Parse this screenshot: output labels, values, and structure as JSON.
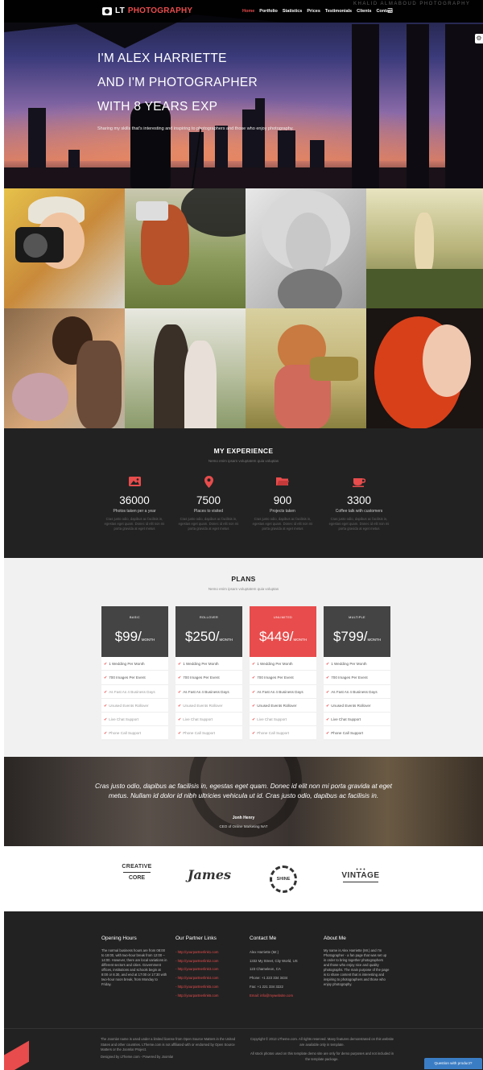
{
  "header": {
    "logo_prefix": "LT",
    "logo_accent": "PHOTOGRAPHY",
    "nav": [
      "Home",
      "Portfolio",
      "Statistics",
      "Prices",
      "Testimonials",
      "Clients",
      "Contact"
    ],
    "watermark": "KHALID ALMABOUD PHOTOGRAPHY"
  },
  "hero": {
    "lines": [
      "I'M ALEX HARRIETTE",
      "AND I'M PHOTOGRAPHER",
      "WITH 8 YEARS EXP"
    ],
    "subtitle": "Sharing my skills that's interesting and inspiring to photographers and those who enjoy photography."
  },
  "experience": {
    "title": "MY EXPERIENCE",
    "subtitle": "Nemo enim ipsam voluptatem quia voluptas",
    "stats": [
      {
        "icon": "image-icon",
        "number": "36000",
        "label": "Photos taken per a year",
        "desc": "Cras justo odio, dapibus ac facilisis in, egestas eget quam. Donec id elit non mi porta gravida at eget metus"
      },
      {
        "icon": "map-pin-icon",
        "number": "7500",
        "label": "Places to visited",
        "desc": "Cras justo odio, dapibus ac facilisis in, egestas eget quam. Donec id elit non mi porta gravida at eget metus"
      },
      {
        "icon": "folder-icon",
        "number": "900",
        "label": "Projects taken",
        "desc": "Cras justo odio, dapibus ac facilisis in, egestas eget quam. Donec id elit non mi porta gravida at eget metus"
      },
      {
        "icon": "coffee-icon",
        "number": "3300",
        "label": "Coffee talk with customers",
        "desc": "Cras justo odio, dapibus ac facilisis in, egestas eget quam. Donec id elit non mi porta gravida at eget metus"
      }
    ]
  },
  "plans": {
    "title": "PLANS",
    "subtitle": "Nemo enim ipsam voluptatem quia voluptas",
    "per": "MONTH",
    "items": [
      {
        "name": "BASIC",
        "price": "$99/",
        "highlight": false,
        "features": [
          [
            "1 Wedding Per Month",
            true
          ],
          [
            "700 Images Per Event",
            true
          ],
          [
            "As Fast As 4 Business Days",
            false
          ],
          [
            "Unused Events Rollover",
            false
          ],
          [
            "Live Chat Support",
            false
          ],
          [
            "Phone Call Support",
            false
          ]
        ]
      },
      {
        "name": "ROLLOVER",
        "price": "$250/",
        "highlight": false,
        "features": [
          [
            "1 Wedding Per Month",
            true
          ],
          [
            "700 Images Per Event",
            true
          ],
          [
            "As Fast As 4 Business Days",
            true
          ],
          [
            "Unused Events Rollover",
            false
          ],
          [
            "Live Chat Support",
            false
          ],
          [
            "Phone Call Support",
            false
          ]
        ]
      },
      {
        "name": "UNLIMITED",
        "price": "$449/",
        "highlight": true,
        "features": [
          [
            "1 Wedding Per Month",
            true
          ],
          [
            "700 Images Per Event",
            true
          ],
          [
            "As Fast As 4 Business Days",
            true
          ],
          [
            "Unused Events Rollover",
            true
          ],
          [
            "Live Chat Support",
            false
          ],
          [
            "Phone Call Support",
            false
          ]
        ]
      },
      {
        "name": "MULTIPLE",
        "price": "$799/",
        "highlight": false,
        "features": [
          [
            "1 Wedding Per Month",
            true
          ],
          [
            "700 Images Per Event",
            true
          ],
          [
            "As Fast As 4 Business Days",
            true
          ],
          [
            "Unused Events Rollover",
            true
          ],
          [
            "Live Chat Support",
            true
          ],
          [
            "Phone Call Support",
            true
          ]
        ]
      }
    ]
  },
  "testimonial": {
    "quote": "Cras justo odio, dapibus ac facilisis in, egestas eget quam. Donec id elit non mi porta gravida at eget metus. Nullam id dolor id nibh ultricies vehicula ut id. Cras justo odio, dapibus ac facilisis in.",
    "author": "Jonh Henry",
    "role": "CEO of Online Marketing NAT"
  },
  "clients": {
    "logo1": [
      "CREATIVE",
      "CORE"
    ],
    "logo2": "James",
    "logo3": "SHINE",
    "logo4": [
      "VINTAGE"
    ]
  },
  "footer": {
    "hours_title": "Opening Hours",
    "hours_text": "The normal business hours are from 08:00 to 18:00, with two-hour break from 12:00 – 14:00. However, there are local variations in different sectors and cities. Government offices, institutions and schools begin at 8:00 or 8.30, and end at 17:00 or 17:30 with two-hour noon break, from Monday to Friday.",
    "partners_title": "Our Partner Links",
    "partners": [
      "- http://yourpartnerlink1.com",
      "- http://yourpartnerlink2.com",
      "- http://yourpartnerlink3.com",
      "- http://yourpartnerlink4.com",
      "- http://yourpartnerlink5.com",
      "- http://yourpartnerlink6.com"
    ],
    "contact_title": "Contact Me",
    "contact": [
      "Alex Harriette (Mr.)",
      "1332 My Street, City World, US",
      "123 Chameleon, CA",
      "Phone: +1 223 334 3434",
      "Fax: +1 221 334 3222"
    ],
    "email": "Email: info@mywebsite.com",
    "about_title": "About Me",
    "about_text": "My name is Alex Harriette (Mr.) and I'm Photographer - a fan page that was set up in order to bring together photographers and those who enjoy nice and quality photographs. The main purpose of the page is to share content that is interesting and inspiring to photographers and those who enjoy photography.",
    "legal_left": "The Joomla! name is used under a limited license from Open Source Matters in the United States and other countries. LTheme.com is not affiliated with or endorsed by Open Source Matters or the Joomla! Project.",
    "designed_by": "Designed by LTheme.com - Powered by Joomla!",
    "legal_right": "Copyright © 2013 LTheme.com. All rights reserved. Many features demonstrated on this website are available only in template.",
    "legal_right2": "All stock photos used on this template demo site are only for demo purposes and not included in the template package.",
    "chat_label": "Question with product?"
  },
  "colors": {
    "accent": "#e84c4c",
    "dark": "#222222",
    "plan_head": "#444444"
  }
}
